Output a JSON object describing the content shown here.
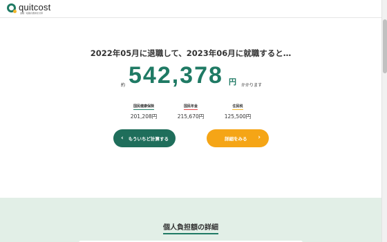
{
  "brand": {
    "name": "quitcost",
    "tagline": "退職・転職の費用を計算"
  },
  "result": {
    "headline": "2022年05月に退職して、2023年06月に就職すると…",
    "prefix": "約",
    "amount": "542,378",
    "unit": "円",
    "suffix": "かかります"
  },
  "breakdown": [
    {
      "label": "国民健康保険",
      "value": "201,208円"
    },
    {
      "label": "国民年金",
      "value": "215,670円"
    },
    {
      "label": "住民税",
      "value": "125,500円"
    }
  ],
  "buttons": {
    "recalc": "もういちど計算する",
    "detail": "詳細をみる"
  },
  "section": {
    "title": "個人負担額の詳細"
  },
  "colors": {
    "brand_green": "#1f7a64",
    "accent_orange": "#f5a516",
    "section_bg": "#e2efe7"
  }
}
